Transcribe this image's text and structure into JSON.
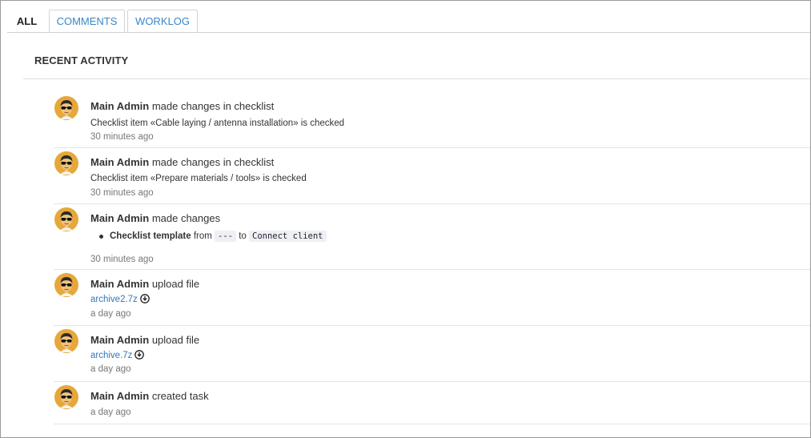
{
  "tabs": [
    {
      "label": "ALL",
      "active": true
    },
    {
      "label": "COMMENTS",
      "active": false
    },
    {
      "label": "WORKLOG",
      "active": false
    }
  ],
  "section_title": "RECENT ACTIVITY",
  "activities": [
    {
      "user": "Main Admin",
      "action": "made changes in checklist",
      "detail": "Checklist item «Cable laying / antenna installation» is checked",
      "time": "30 minutes ago"
    },
    {
      "user": "Main Admin",
      "action": "made changes in checklist",
      "detail": "Checklist item «Prepare materials / tools» is checked",
      "time": "30 minutes ago"
    },
    {
      "user": "Main Admin",
      "action": "made changes",
      "change": {
        "field": "Checklist template",
        "from_word": "from",
        "from_value": "---",
        "to_word": "to",
        "to_value": "Connect client"
      },
      "time": "30 minutes ago"
    },
    {
      "user": "Main Admin",
      "action": "upload file",
      "file": "archive2.7z",
      "time": "a day ago"
    },
    {
      "user": "Main Admin",
      "action": "upload file",
      "file": "archive.7z",
      "time": "a day ago"
    },
    {
      "user": "Main Admin",
      "action": "created task",
      "time": "a day ago"
    }
  ],
  "icons": {
    "avatar": "user-avatar-sunglasses",
    "download": "download-circle-icon"
  },
  "colors": {
    "link": "#2f78be",
    "muted": "#777777",
    "avatar_bg": "#e6a83a"
  }
}
